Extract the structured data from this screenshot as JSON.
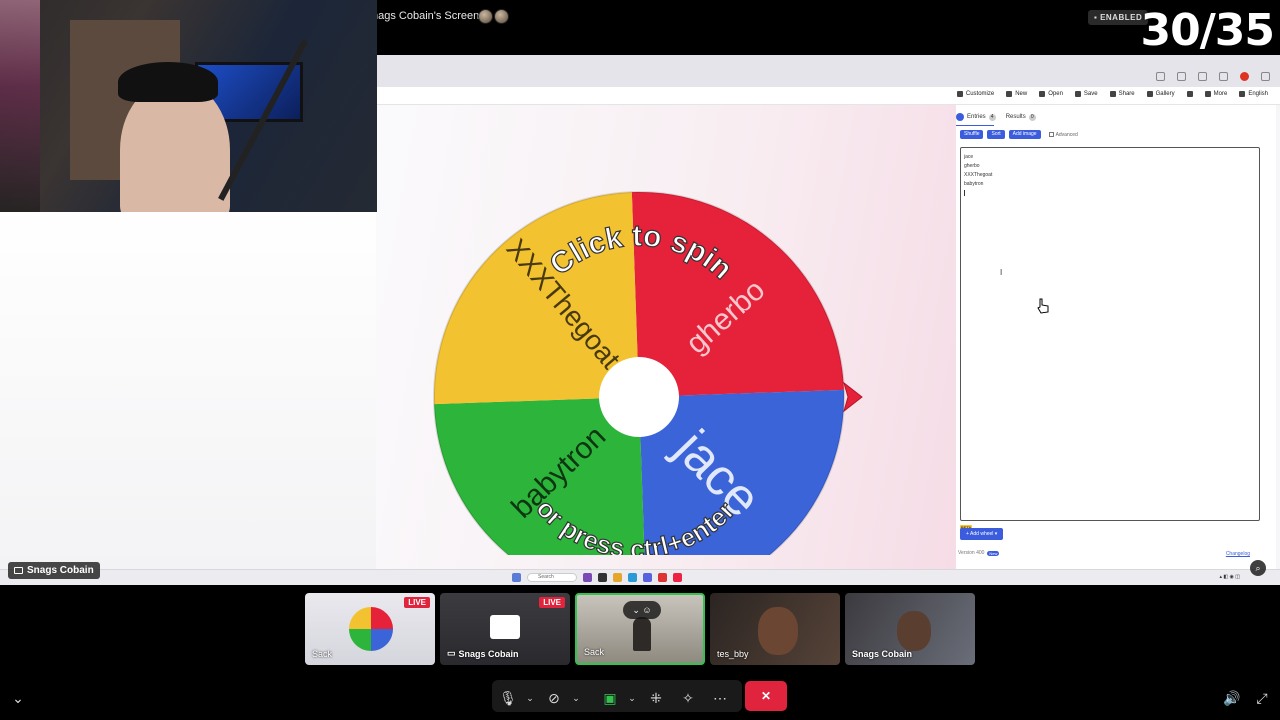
{
  "topbar": {
    "screen_title": "nags Cobain's Screen",
    "enabled_label": "ENABLED",
    "counter": "30/35"
  },
  "webcam": {
    "name_label": "Snags Cobain"
  },
  "site": {
    "toolbar": [
      {
        "icon": "customize-icon",
        "label": "Customize"
      },
      {
        "icon": "new-icon",
        "label": "New"
      },
      {
        "icon": "open-icon",
        "label": "Open"
      },
      {
        "icon": "save-icon",
        "label": "Save"
      },
      {
        "icon": "share-icon",
        "label": "Share"
      },
      {
        "icon": "gallery-icon",
        "label": "Gallery"
      },
      {
        "icon": "fullscreen-icon",
        "label": ""
      },
      {
        "icon": "more-icon",
        "label": "More"
      },
      {
        "icon": "globe-icon",
        "label": "English"
      }
    ],
    "wheel": {
      "segments": [
        {
          "label": "gherbo",
          "color": "#e6213a"
        },
        {
          "label": "jace",
          "color": "#3a64d8"
        },
        {
          "label": "babytron",
          "color": "#2db43a"
        },
        {
          "label": "XXXThegoat",
          "color": "#f2c230"
        }
      ],
      "overlay_top": "Click to spin",
      "overlay_bottom": "or press ctrl+enter"
    },
    "panel": {
      "tab_entries": "Entries",
      "entries_count": "4",
      "tab_results": "Results",
      "results_count": "0",
      "btn_shuffle": "Shuffle",
      "btn_sort": "Sort",
      "btn_add_image": "Add image",
      "advanced_label": "Advanced",
      "entries": [
        "jace",
        "gherbo",
        "XXXThegoat",
        "babytron"
      ],
      "beta": "BETA",
      "add_wheel": "Add wheel",
      "version": "Version 400",
      "version_badge": "New",
      "changelog": "Changelog"
    },
    "taskbar_search": "Search"
  },
  "thumbnails": [
    {
      "label": "Sack",
      "live": "LIVE",
      "bold": false
    },
    {
      "label": "Snags Cobain",
      "live": "LIVE",
      "bold": true
    },
    {
      "label": "Sack",
      "live": "",
      "bold": false
    },
    {
      "label": "tes_bby",
      "live": "",
      "bold": false
    },
    {
      "label": "Snags Cobain",
      "live": "",
      "bold": true
    }
  ],
  "colors": {
    "accent": "#3b5ddd",
    "live": "#e0243e",
    "active_border": "#33c24f"
  }
}
